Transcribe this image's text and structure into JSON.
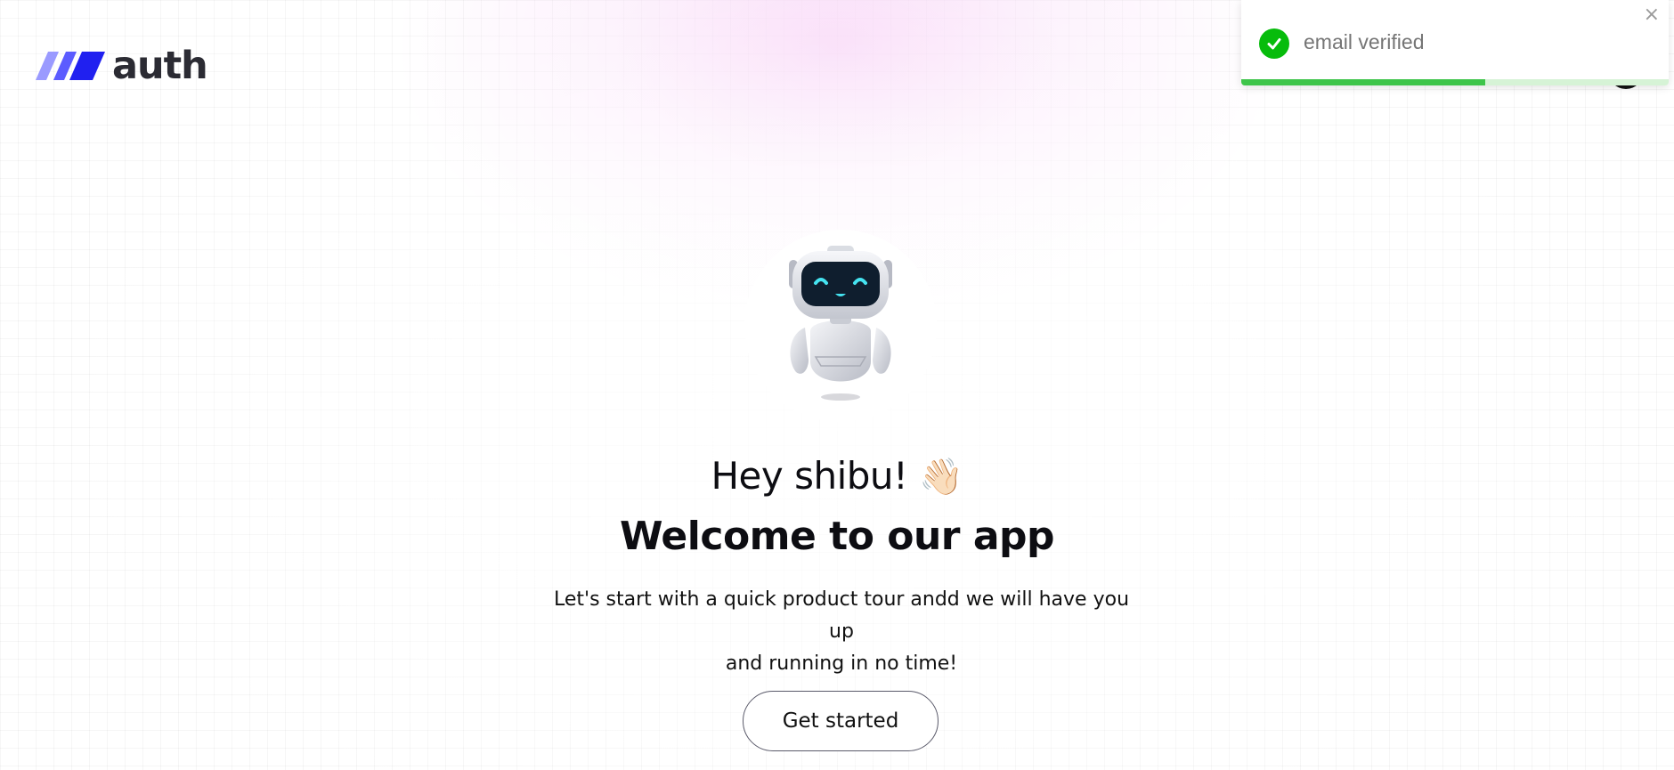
{
  "header": {
    "logo_text": "auth",
    "logo_icon": "slash-stripes-logo-icon"
  },
  "user": {
    "avatar_icon": "user-avatar-icon"
  },
  "toast": {
    "message": "email verified",
    "status_icon": "check-circle-icon",
    "close_glyph": "×",
    "progress_fraction": 0.57,
    "colors": {
      "success": "#07bc0c",
      "progress": "#3ec54a",
      "progress_track": "#d6f3d6"
    }
  },
  "hero": {
    "mascot_icon": "robot-mascot-icon",
    "greeting": "Hey shibu!",
    "greeting_emoji": "👋🏻",
    "title": "Welcome to our app",
    "subtitle_line1": "Let's start with a quick product tour andd we will have you up",
    "subtitle_line2": "and running in no time!",
    "cta_label": "Get started"
  },
  "colors": {
    "logo_blue_dark": "#2020f0",
    "logo_blue_light": "#8c8cff",
    "text": "#0d0d12",
    "glow_pink": "#f7cdf5"
  }
}
